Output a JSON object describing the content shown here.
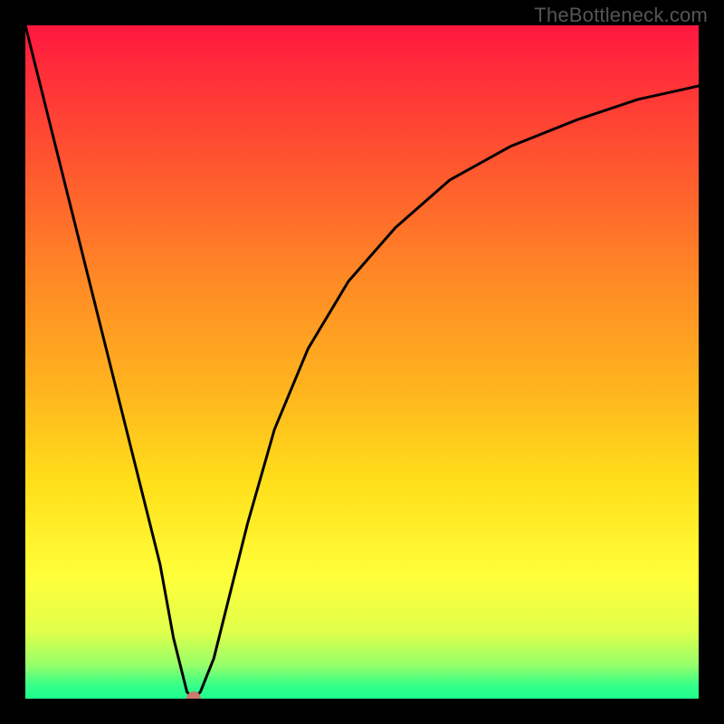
{
  "watermark": "TheBottleneck.com",
  "chart_data": {
    "type": "line",
    "title": "",
    "xlabel": "",
    "ylabel": "",
    "xlim": [
      0,
      100
    ],
    "ylim": [
      0,
      100
    ],
    "grid": false,
    "legend": false,
    "gradient_bands": [
      {
        "pos": 0,
        "color": "#ff163f"
      },
      {
        "pos": 0.22,
        "color": "#ff5a2e"
      },
      {
        "pos": 0.54,
        "color": "#ffb41e"
      },
      {
        "pos": 0.82,
        "color": "#ffff3a"
      },
      {
        "pos": 0.95,
        "color": "#97ff6a"
      },
      {
        "pos": 1.0,
        "color": "#1cff8e"
      }
    ],
    "series": [
      {
        "name": "bottleneck-curve",
        "x": [
          0,
          5,
          10,
          15,
          20,
          22,
          24,
          25,
          26,
          28,
          30,
          33,
          37,
          42,
          48,
          55,
          63,
          72,
          82,
          91,
          100
        ],
        "y": [
          100,
          80,
          60,
          40,
          20,
          9,
          1,
          0,
          1,
          6,
          14,
          26,
          40,
          52,
          62,
          70,
          77,
          82,
          86,
          89,
          91
        ]
      }
    ],
    "marker": {
      "x": 25,
      "y": 0
    }
  },
  "accent_colors": {
    "curve": "#000000",
    "marker": "#cc7a6e",
    "frame": "#000000"
  }
}
